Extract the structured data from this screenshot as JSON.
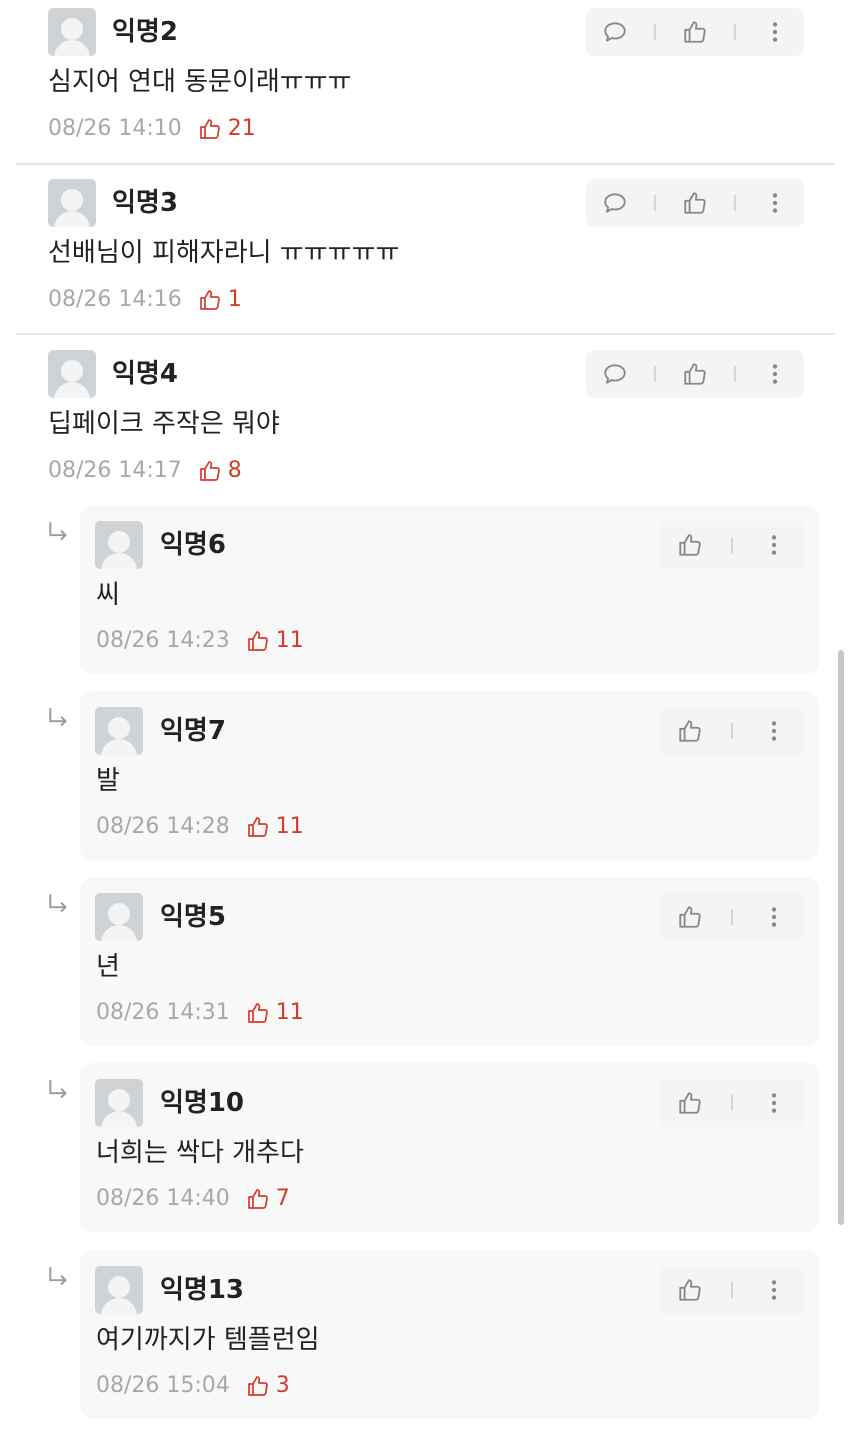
{
  "comments": [
    {
      "author": "익명2",
      "text": "심지어 연대 동문이래ㅠㅠㅠ",
      "time": "08/26 14:10",
      "likes": "21"
    },
    {
      "author": "익명3",
      "text": "선배님이 피해자라니 ㅠㅠㅠㅠㅠ",
      "time": "08/26 14:16",
      "likes": "1"
    },
    {
      "author": "익명4",
      "text": "딥페이크 주작은 뭐야",
      "time": "08/26 14:17",
      "likes": "8"
    }
  ],
  "replies": [
    {
      "author": "익명6",
      "text": "씨",
      "time": "08/26 14:23",
      "likes": "11"
    },
    {
      "author": "익명7",
      "text": "발",
      "time": "08/26 14:28",
      "likes": "11"
    },
    {
      "author": "익명5",
      "text": "년",
      "time": "08/26 14:31",
      "likes": "11"
    },
    {
      "author": "익명10",
      "text": "너희는 싹다 개추다",
      "time": "08/26 14:40",
      "likes": "7"
    },
    {
      "author": "익명13",
      "text": "여기까지가 템플런임",
      "time": "08/26 15:04",
      "likes": "3"
    }
  ],
  "colors": {
    "accent": "#d23c2a",
    "meta": "#a8a8a8",
    "reply_bg": "#f8f8f8",
    "action_bg": "#f4f4f4"
  },
  "icons": [
    "comment-icon",
    "thumbs-up-icon",
    "more-vertical-icon",
    "reply-arrow-icon",
    "avatar-icon"
  ]
}
